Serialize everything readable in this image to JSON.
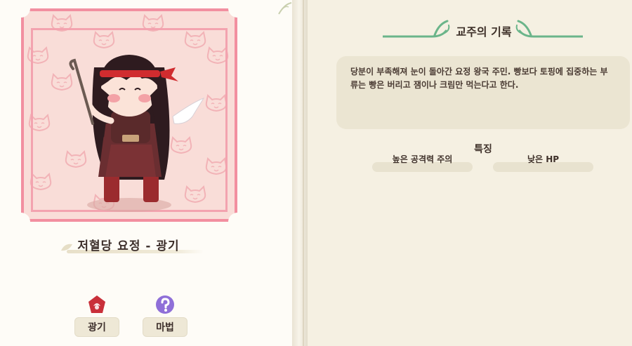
{
  "character": {
    "name": "저혈당 요정 - 광기"
  },
  "traits": [
    {
      "label": "광기",
      "icon": "madness-icon",
      "color": "#c9303a"
    },
    {
      "label": "마법",
      "icon": "magic-icon",
      "color": "#8f6fd8"
    }
  ],
  "record": {
    "title": "교주의 기록",
    "description": "당분이 부족해져 눈이 돌아간 요정 왕국 주민. 빵보다 토핑에 집중하는 부류는 빵은 버리고 잼이나 크림만 먹는다고 한다."
  },
  "features": {
    "title": "특징",
    "items": [
      "높은 공격력 주의",
      "낮은 HP"
    ]
  },
  "colors": {
    "frame": "#f28fa0",
    "portrait_bg": "#f9ddd8",
    "accent_green": "#6bb58a",
    "page": "#f5f0e2"
  }
}
